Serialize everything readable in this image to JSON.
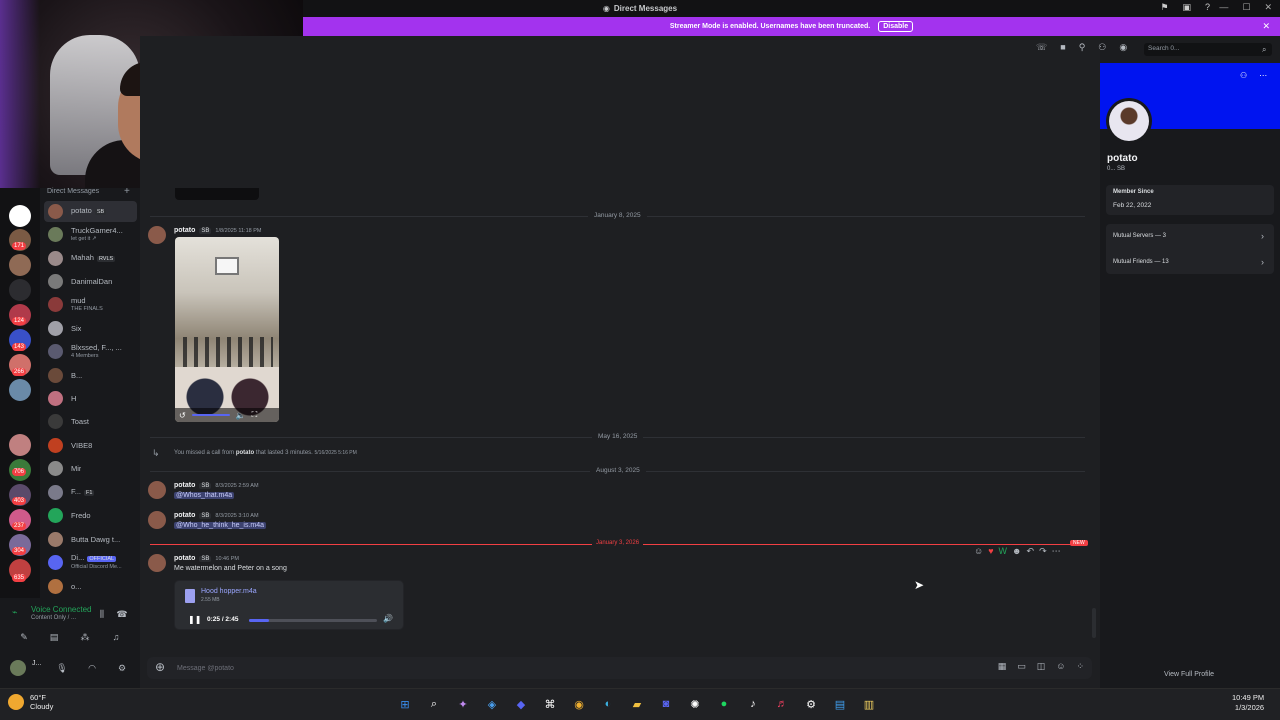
{
  "titlebar": {
    "title": "Direct Messages"
  },
  "streamer": {
    "text": "Streamer Mode is enabled. Usernames have been truncated.",
    "button": "Disable"
  },
  "search": {
    "placeholder": "Search 0..."
  },
  "dm_header": "Direct Messages",
  "guild_badges": [
    "171",
    "124",
    "143",
    "266",
    "706",
    "403",
    "237",
    "304",
    "635"
  ],
  "dms": [
    {
      "name": "potato",
      "tag": "SB",
      "sub": "",
      "active": true
    },
    {
      "name": "TruckGamer4...",
      "tag": "",
      "sub": "let get it ↗",
      "active": false
    },
    {
      "name": "Mahah",
      "tag": "RVLS",
      "sub": "",
      "active": false
    },
    {
      "name": "DanimalDan",
      "tag": "",
      "sub": "",
      "active": false
    },
    {
      "name": "mud",
      "tag": "",
      "sub": "THE FINALS",
      "active": false
    },
    {
      "name": "Six",
      "tag": "",
      "sub": "",
      "active": false
    },
    {
      "name": "Blxssed, F..., ...",
      "tag": "",
      "sub": "4 Members",
      "active": false
    },
    {
      "name": "B...",
      "tag": "",
      "sub": "",
      "active": false
    },
    {
      "name": "H",
      "tag": "",
      "sub": "",
      "active": false
    },
    {
      "name": "Toast",
      "tag": "",
      "sub": "",
      "active": false
    },
    {
      "name": "VIBE8",
      "tag": "",
      "sub": "",
      "active": false
    },
    {
      "name": "Mir",
      "tag": "",
      "sub": "",
      "active": false
    },
    {
      "name": "F...",
      "tag": "F1",
      "sub": "",
      "active": false
    },
    {
      "name": "Fredo",
      "tag": "",
      "sub": "",
      "active": false
    },
    {
      "name": "Butta Dawg t...",
      "tag": "",
      "sub": "",
      "active": false
    },
    {
      "name": "Di...",
      "tag": "OFFICIAL",
      "sub": "Official Discord Me...",
      "active": false
    },
    {
      "name": "o...",
      "tag": "",
      "sub": "",
      "active": false
    }
  ],
  "voice": {
    "status": "Voice Connected",
    "sub": "Content Only / ..."
  },
  "user": {
    "name": "J..."
  },
  "messages": {
    "date1": "January 8, 2025",
    "m1": {
      "author": "potato",
      "tag": "SB",
      "time": "1/8/2025 11:18 PM"
    },
    "date2": "May 16, 2025",
    "call": {
      "prefix": "You missed a call from ",
      "who": "potato",
      "suffix": " that lasted 3 minutes. ",
      "time": "5/16/2025 5:16 PM"
    },
    "date3": "August 3, 2025",
    "m2": {
      "author": "potato",
      "tag": "SB",
      "time": "8/3/2025 2:59 AM",
      "text": "@Whos_that.m4a"
    },
    "m3": {
      "author": "potato",
      "tag": "SB",
      "time": "8/3/2025 3:10 AM",
      "text": "@Who_he_think_he_is.m4a"
    },
    "date4": "January 3, 2026",
    "new_label": "NEW",
    "m4": {
      "author": "potato",
      "tag": "SB",
      "time": "10:46 PM",
      "text": "Me watermelon and Peter on a song"
    },
    "audio": {
      "filename": "Hood hopper.m4a",
      "size": "2.55 MB",
      "time": "0:25 / 2:45",
      "progress": 0.16
    }
  },
  "composer": {
    "placeholder": "Message @potato"
  },
  "profile": {
    "name": "potato",
    "sub": "0...  SB",
    "member_since_label": "Member Since",
    "member_since": "Feb 22, 2022",
    "mutual_servers": "Mutual Servers — 3",
    "mutual_friends": "Mutual Friends — 13",
    "view_full": "View Full Profile"
  },
  "weather": {
    "temp": "60°F",
    "cond": "Cloudy"
  },
  "clock": {
    "time": "10:49 PM",
    "date": "1/3/2026"
  },
  "colors": {
    "accent": "#5865f2",
    "streamer": "#a333ee",
    "banner": "#0014f0",
    "new": "#f23f43"
  }
}
